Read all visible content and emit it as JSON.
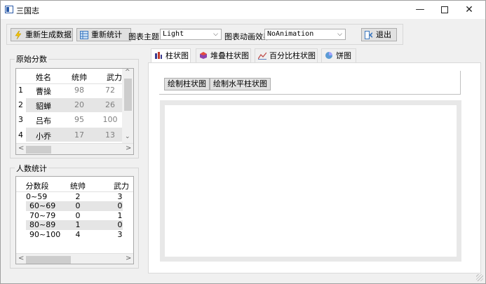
{
  "window": {
    "title": "三国志",
    "minimize": "—",
    "close": "✕"
  },
  "toolbar": {
    "regen_label": "重新生成数据",
    "restat_label": "重新统计",
    "theme_label": "图表主题",
    "theme_value": "Light",
    "anim_label": "图表动画效果",
    "anim_value": "NoAnimation",
    "exit_label": "退出"
  },
  "scores": {
    "title": "原始分数",
    "headers": [
      "姓名",
      "统帅",
      "武力"
    ],
    "rows": [
      {
        "index": "1",
        "name": "曹操",
        "lead": "98",
        "force": "72"
      },
      {
        "index": "2",
        "name": "貂蝉",
        "lead": "20",
        "force": "26"
      },
      {
        "index": "3",
        "name": "吕布",
        "lead": "95",
        "force": "100"
      },
      {
        "index": "4",
        "name": "小乔",
        "lead": "17",
        "force": "13"
      }
    ]
  },
  "stats": {
    "title": "人数统计",
    "headers": [
      "分数段",
      "统帅",
      "武力"
    ],
    "rows": [
      {
        "range": "0~59",
        "lead": "2",
        "force": "3"
      },
      {
        "range": "60~69",
        "lead": "0",
        "force": "0"
      },
      {
        "range": "70~79",
        "lead": "0",
        "force": "1"
      },
      {
        "range": "80~89",
        "lead": "1",
        "force": "0"
      },
      {
        "range": "90~100",
        "lead": "4",
        "force": "3"
      }
    ]
  },
  "tabs": [
    {
      "label": "柱状图",
      "active": true
    },
    {
      "label": "堆叠柱状图",
      "active": false
    },
    {
      "label": "百分比柱状图",
      "active": false
    },
    {
      "label": "饼图",
      "active": false
    }
  ],
  "panel": {
    "draw_bar_label": "绘制柱状图",
    "draw_hbar_label": "绘制水平柱状图"
  },
  "colors": {
    "accent": "#0078d7",
    "selected_row": "#e5e5e5"
  }
}
